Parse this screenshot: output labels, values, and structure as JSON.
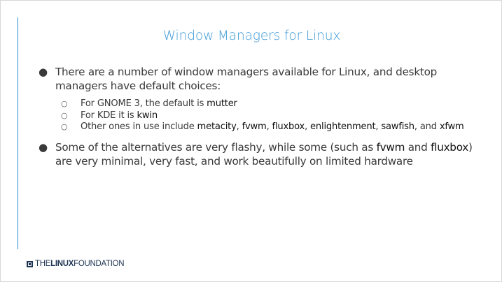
{
  "slide": {
    "title": "Window Managers for Linux",
    "bullets": [
      {
        "text": "There are a number of window managers available for Linux, and desktop managers have default choices:",
        "subs": [
          {
            "prefix": "For GNOME 3, the default is ",
            "keyword": "mutter"
          },
          {
            "prefix": "For KDE it is ",
            "keyword": "kwin"
          },
          {
            "prefix": "Other ones in use include ",
            "k1": "metacity",
            "s1": ", ",
            "k2": "fvwm",
            "s2": ", ",
            "k3": "fluxbox",
            "s3": ", ",
            "k4": "enlightenment",
            "s4": ", ",
            "k5": "sawfish",
            "s5": ", and ",
            "k6": "xfwm"
          }
        ]
      },
      {
        "t1": "Some of the alternatives are very flashy, while some (such as ",
        "k1": "fvwm",
        "t2": " and ",
        "k2": "fluxbox",
        "t3": ") are very minimal, very fast, and work beautifully on limited hardware"
      }
    ],
    "bullet_glyph": "●",
    "sub_glyph": "○"
  },
  "footer": {
    "logo_the": "THE",
    "logo_linux": "LINUX",
    "logo_foundation": "FOUNDATION"
  },
  "colors": {
    "title": "#3d9ad8",
    "accent_line": "#2e8fd0",
    "logo": "#1f3454"
  }
}
